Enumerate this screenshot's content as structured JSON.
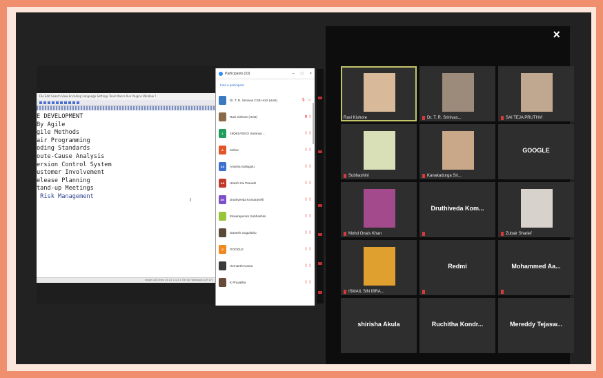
{
  "editor": {
    "window_title": "Note 23 - Notepad++",
    "menu_line": "File  Edit  Search  View  Encoding  Language  Settings  Tools  Macro  Run  Plugins  Window  ?",
    "lines": [
      "E DEVELOPMENT",
      "By Agile",
      "gile Methods",
      "air Programming",
      "oding Standards",
      "oute-Cause Analysis",
      "ersion Control System",
      "ustomer Involvement",
      "elease Planning",
      "tand-up Meetings",
      " Risk Management"
    ],
    "cursor_mark": "I",
    "status_text": "length 105   lines 15      Ln 1  Col 1   Sel 0|0   Windows (CR LF)"
  },
  "participants": {
    "title": "Participants (33)",
    "find_placeholder": "Find a participant",
    "rows": [
      {
        "name": "Dr. T. R. Srinivas CSE HoD (Host)",
        "initials": "",
        "color": "#3a7bbf",
        "icons": "🎙 ▭"
      },
      {
        "name": "Ravi Kishore (Host)",
        "initials": "",
        "color": "#8b6a4a",
        "icons": "▮ ▯"
      },
      {
        "name": "19Q91A05XX Saranya ...",
        "initials": "1",
        "color": "#1f9d5a",
        "icons": "▯ ▯"
      },
      {
        "name": "Kishor",
        "initials": "A",
        "color": "#e2552b",
        "icons": "▯ ▯"
      },
      {
        "name": "Anusha Sollagolu",
        "initials": "AS",
        "color": "#3d6fd0",
        "icons": "▯ ▯"
      },
      {
        "name": "Hitesh Sai Pranath",
        "initials": "AS",
        "color": "#c0392b",
        "icons": "▯ ▯"
      },
      {
        "name": "Druthveeda Komaravelli",
        "initials": "DK",
        "color": "#7b4fc9",
        "icons": "▯ ▯"
      },
      {
        "name": "Eswarapuram Subhashini",
        "initials": "",
        "color": "#9ac43a",
        "icons": "▯ ▯"
      },
      {
        "name": "Ganesh Gugulothu",
        "initials": "",
        "color": "#5a4a3a",
        "icons": "▯ ▯"
      },
      {
        "name": "GOOGLE",
        "initials": "G",
        "color": "#f08a1e",
        "icons": "▯ ▯"
      },
      {
        "name": "Hemanth Kumar",
        "initials": "",
        "color": "#3a3a3a",
        "icons": "▯ ▯"
      },
      {
        "name": "K Pravalika",
        "initials": "",
        "color": "#6a4a3a",
        "icons": "▯ ▯"
      }
    ]
  },
  "gallery": {
    "close_symbol": "×",
    "tiles": [
      {
        "label": "Ravi Kishore",
        "center": "",
        "muted": false,
        "active": true,
        "pic": "#d8b99a"
      },
      {
        "label": "Dr. T. R. Srinivas...",
        "center": "",
        "muted": true,
        "active": false,
        "pic": "#9c8a7a"
      },
      {
        "label": "SAI TEJA PRUTHVI",
        "center": "",
        "muted": true,
        "active": false,
        "pic": "#c0a890"
      },
      {
        "label": "Subhashini",
        "center": "",
        "muted": true,
        "active": false,
        "pic": "#d9e0b8"
      },
      {
        "label": "Kanakadurga Sri...",
        "center": "",
        "muted": true,
        "active": false,
        "pic": "#c9a88a"
      },
      {
        "label": "",
        "center": "GOOGLE",
        "muted": false,
        "active": false,
        "pic": ""
      },
      {
        "label": "Mohd Onais Khan",
        "center": "",
        "muted": true,
        "active": false,
        "pic": "#a24a8c"
      },
      {
        "label": "",
        "center": "Druthiveda Kom...",
        "muted": true,
        "active": false,
        "pic": ""
      },
      {
        "label": "Zubair Sharief",
        "center": "",
        "muted": true,
        "active": false,
        "pic": "#d8d2cc"
      },
      {
        "label": "ISMAIL SIN IBRA...",
        "center": "",
        "muted": true,
        "active": false,
        "pic": "#e0a030"
      },
      {
        "label": "",
        "center": "Redmi",
        "muted": true,
        "active": false,
        "pic": ""
      },
      {
        "label": "",
        "center": "Mohammed Aa...",
        "muted": true,
        "active": false,
        "pic": ""
      },
      {
        "label": "",
        "center": "shirisha Akula",
        "muted": false,
        "active": false,
        "pic": ""
      },
      {
        "label": "",
        "center": "Ruchitha Kondr...",
        "muted": false,
        "active": false,
        "pic": ""
      },
      {
        "label": "",
        "center": "Mereddy Tejasw...",
        "muted": false,
        "active": false,
        "pic": ""
      }
    ]
  }
}
